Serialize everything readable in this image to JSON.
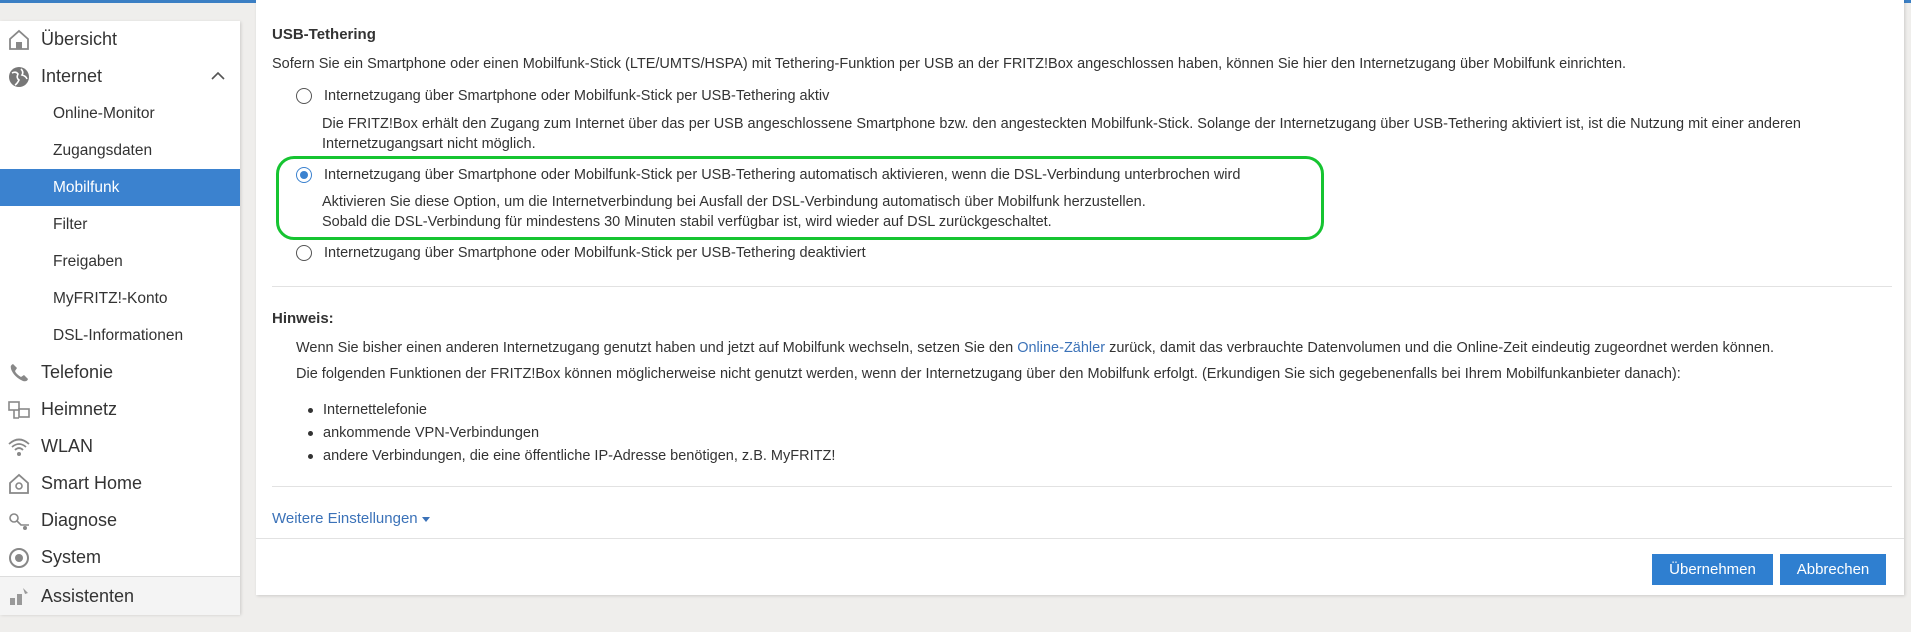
{
  "colors": {
    "accent": "#3b82cf",
    "highlight": "#16c431",
    "link": "#3b72b8"
  },
  "sidebar": {
    "items": [
      {
        "label": "Übersicht",
        "icon": "home-icon"
      },
      {
        "label": "Internet",
        "icon": "globe-icon",
        "expanded": true
      },
      {
        "label": "Telefonie",
        "icon": "phone-icon"
      },
      {
        "label": "Heimnetz",
        "icon": "network-icon"
      },
      {
        "label": "WLAN",
        "icon": "wifi-icon"
      },
      {
        "label": "Smart Home",
        "icon": "smarthome-icon"
      },
      {
        "label": "Diagnose",
        "icon": "diagnose-icon"
      },
      {
        "label": "System",
        "icon": "system-icon"
      },
      {
        "label": "Assistenten",
        "icon": "wizard-icon"
      }
    ],
    "internet_sub": [
      {
        "label": "Online-Monitor"
      },
      {
        "label": "Zugangsdaten"
      },
      {
        "label": "Mobilfunk",
        "active": true
      },
      {
        "label": "Filter"
      },
      {
        "label": "Freigaben"
      },
      {
        "label": "MyFRITZ!-Konto"
      },
      {
        "label": "DSL-Informationen"
      }
    ]
  },
  "main": {
    "section_title": "USB-Tethering",
    "intro": "Sofern Sie ein Smartphone oder einen Mobilfunk-Stick (LTE/UMTS/HSPA) mit Tethering-Funktion per USB an der FRITZ!Box angeschlossen haben, können Sie hier den Internetzugang über Mobilfunk einrichten.",
    "options": [
      {
        "label": "Internetzugang über Smartphone oder Mobilfunk-Stick per USB-Tethering aktiv",
        "checked": false,
        "desc1": "Die FRITZ!Box erhält den Zugang zum Internet über das per USB angeschlossene Smartphone bzw. den angesteckten Mobilfunk-Stick. Solange der Internetzugang über USB-Tethering aktiviert ist, ist die Nutzung mit einer anderen",
        "desc2": "Internetzugangsart nicht möglich."
      },
      {
        "label": "Internetzugang über Smartphone oder Mobilfunk-Stick per USB-Tethering automatisch aktivieren, wenn die DSL-Verbindung unterbrochen wird",
        "checked": true,
        "desc1": "Aktivieren Sie diese Option, um die Internetverbindung bei Ausfall der DSL-Verbindung automatisch über Mobilfunk herzustellen.",
        "desc2": "Sobald die DSL-Verbindung für mindestens 30 Minuten stabil verfügbar ist, wird wieder auf DSL zurückgeschaltet."
      },
      {
        "label": "Internetzugang über Smartphone oder Mobilfunk-Stick per USB-Tethering deaktiviert",
        "checked": false
      }
    ],
    "hint": {
      "title": "Hinweis:",
      "line1_pre": "Wenn Sie bisher einen anderen Internetzugang genutzt haben und jetzt auf Mobilfunk wechseln, setzen Sie den ",
      "line1_link": "Online-Zähler",
      "line1_post": " zurück, damit das verbrauchte Datenvolumen und die Online-Zeit eindeutig zugeordnet werden können.",
      "line2": "Die folgenden Funktionen der FRITZ!Box können möglicherweise nicht genutzt werden, wenn der Internetzugang über den Mobilfunk erfolgt. (Erkundigen Sie sich gegebenenfalls bei Ihrem Mobilfunkanbieter danach):",
      "bullets": [
        "Internettelefonie",
        "ankommende VPN-Verbindungen",
        "andere Verbindungen, die eine öffentliche IP-Adresse benötigen, z.B. MyFRITZ!"
      ]
    },
    "more_settings": "Weitere Einstellungen",
    "buttons": {
      "apply": "Übernehmen",
      "cancel": "Abbrechen"
    }
  }
}
